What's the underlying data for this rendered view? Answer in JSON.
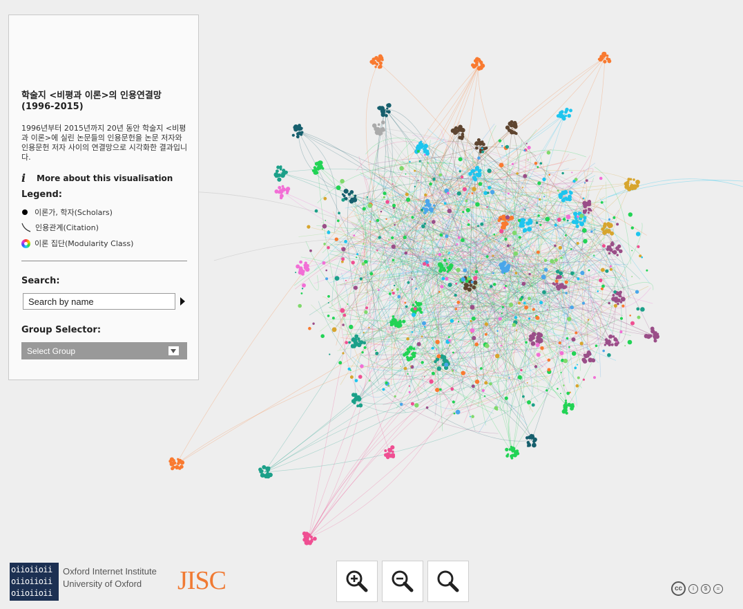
{
  "panel": {
    "title": "학술지 <비평과 이론>의 인용연결망 (1996-2015)",
    "description": "1996년부터 2015년까지 20년 동안 학술지 <비평과 이론>에 실린 논문들의 인용문헌을 논문 저자와 인용문헌 저자 사이의 연결망으로 시각화한 결과입니다.",
    "more_link": "More about this visualisation",
    "info_icon": "info-icon",
    "legend_title": "Legend:",
    "legend": {
      "node": "이론가, 학자(Scholars)",
      "edge": "인용관계(Citation)",
      "color": "이론 집단(Modularity Class)"
    },
    "search_label": "Search:",
    "search_placeholder": "Search by name",
    "group_label": "Group Selector:",
    "group_select_value": "Select Group"
  },
  "footer": {
    "oii_logo_lines": [
      "oiioiioii",
      "oiioiioii",
      "oiioiioii"
    ],
    "oii_name": "Oxford Internet Institute",
    "oii_university": "University of Oxford",
    "jisc": "JISC",
    "zoom_buttons": [
      "zoom-in-icon",
      "zoom-out-icon",
      "zoom-reset-icon"
    ],
    "license_icons": [
      "creative-commons-icon",
      "attribution-icon",
      "noncommercial-icon",
      "no-derivatives-icon"
    ]
  },
  "colors": {
    "orange": "#f97a30",
    "cyan": "#1ec5ee",
    "blue": "#4aa6ea",
    "green": "#22d355",
    "light_green": "#7fd96b",
    "pink": "#f26fd6",
    "rose": "#ef4f92",
    "purple": "#9a4e88",
    "gold": "#d7a52e",
    "teal": "#1ca089",
    "dark_teal": "#165f6d",
    "brown": "#5e4530",
    "grey": "#aaaaaa",
    "panel_background": "#fafafa",
    "select_background": "#999999",
    "oii_navy": "#1c3052",
    "jisc_orange": "#f07a33"
  }
}
